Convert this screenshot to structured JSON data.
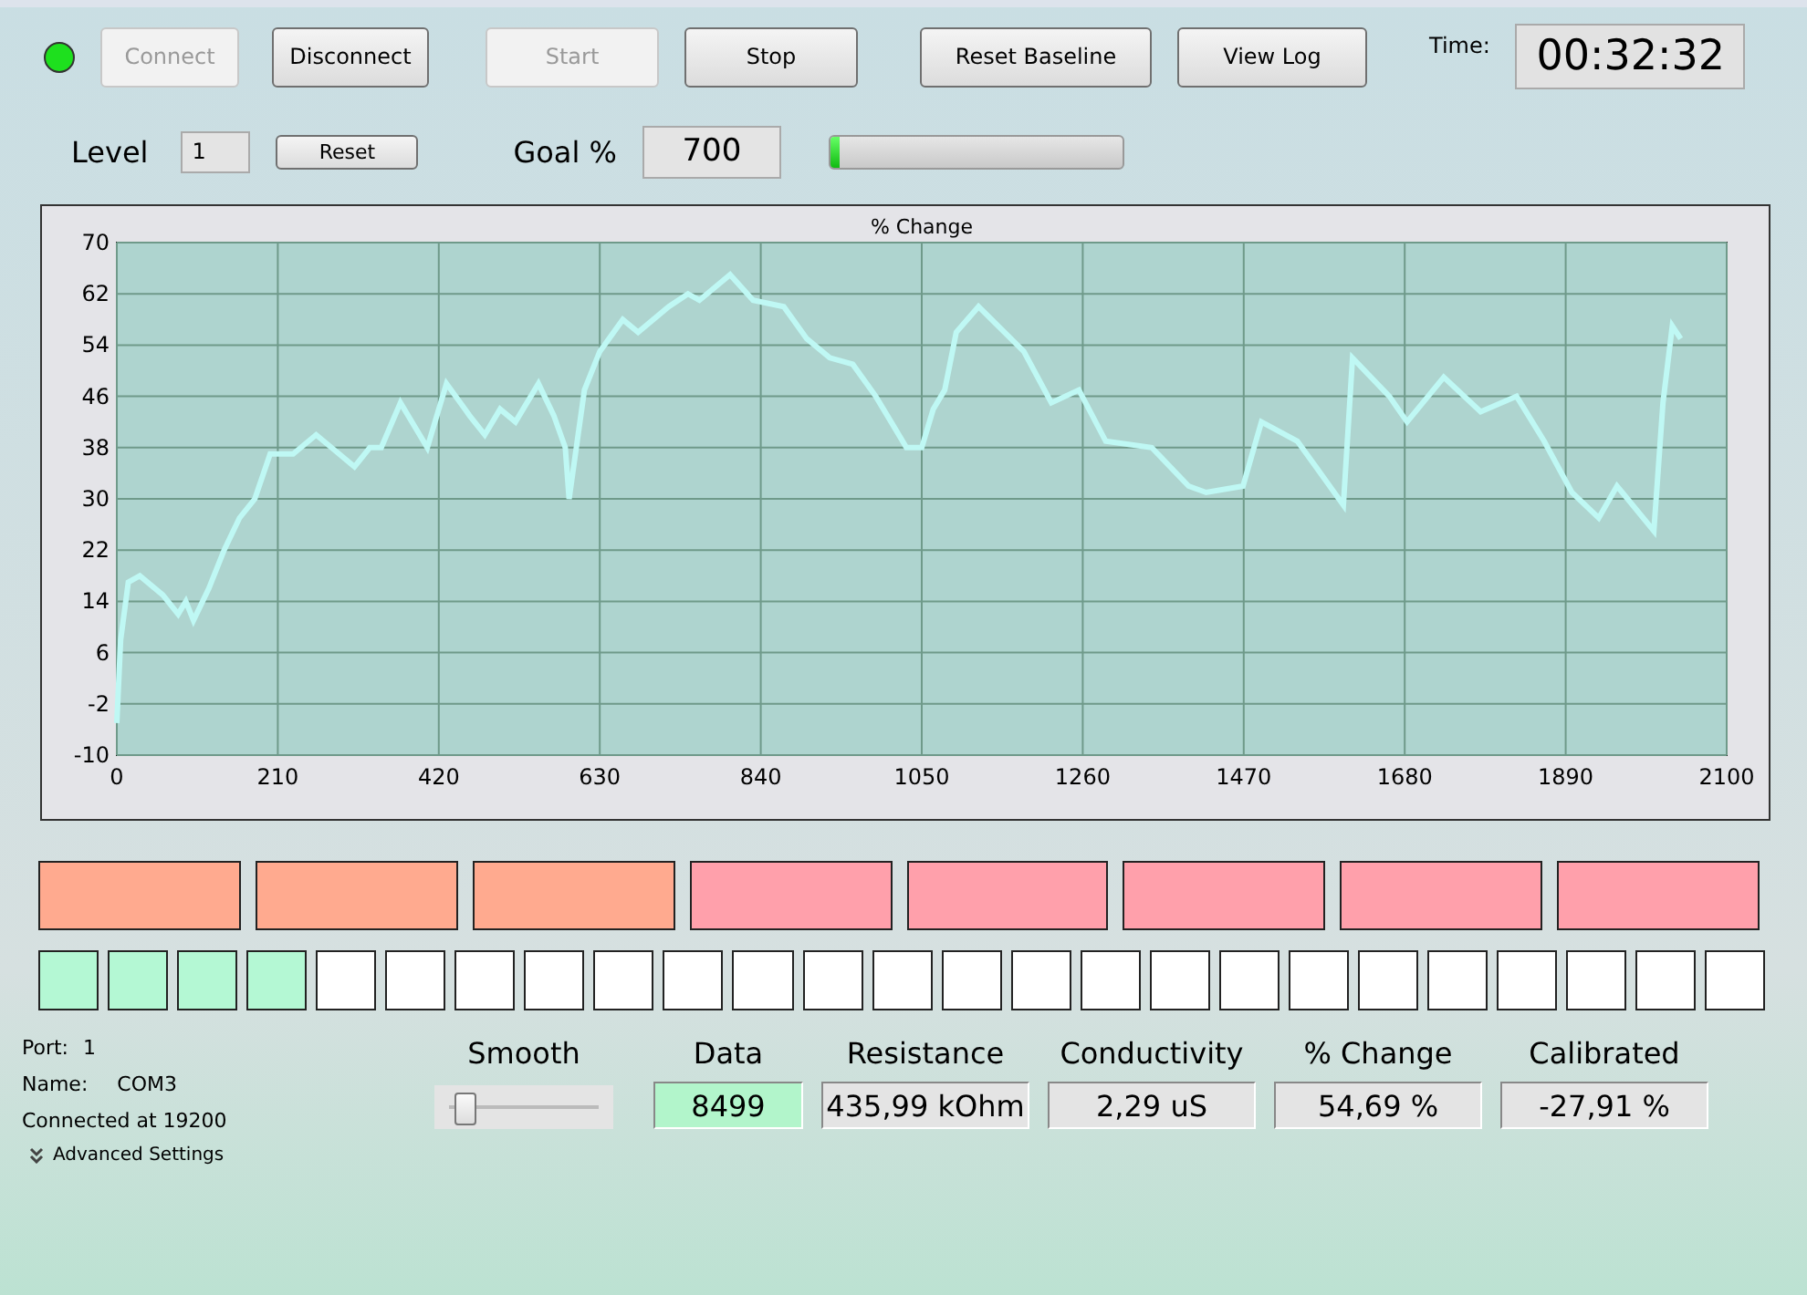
{
  "status_led": {
    "connected": true
  },
  "toolbar_buttons": [
    {
      "label": "Connect",
      "disabled": true
    },
    {
      "label": "Disconnect",
      "disabled": false
    },
    {
      "label": "Start",
      "disabled": true
    },
    {
      "label": "Stop",
      "disabled": false
    },
    {
      "label": "Reset Baseline",
      "disabled": false
    },
    {
      "label": "View Log",
      "disabled": false
    }
  ],
  "time": {
    "label": "Time:",
    "value": "00:32:32"
  },
  "level": {
    "label": "Level",
    "value": "1",
    "reset_button": "Reset"
  },
  "goal": {
    "label": "Goal %",
    "value": "700",
    "progress": {
      "level": 0.03
    }
  },
  "chart": {
    "chart_data": {
      "type": "line",
      "title": "% Change",
      "xlim": [
        0,
        2100
      ],
      "ylim": [
        -10,
        70
      ],
      "xticks": [
        0,
        210,
        420,
        630,
        840,
        1050,
        1260,
        1470,
        1680,
        1890,
        2100
      ],
      "yticks": [
        -10,
        -2,
        6,
        14,
        22,
        30,
        38,
        46,
        54,
        62,
        70
      ],
      "x": [
        0,
        5,
        15,
        30,
        60,
        80,
        90,
        100,
        120,
        140,
        160,
        180,
        200,
        230,
        260,
        290,
        310,
        330,
        345,
        370,
        390,
        405,
        430,
        460,
        480,
        500,
        520,
        550,
        570,
        585,
        590,
        610,
        630,
        660,
        680,
        720,
        745,
        760,
        800,
        830,
        870,
        900,
        930,
        960,
        990,
        1010,
        1030,
        1050,
        1065,
        1080,
        1095,
        1124,
        1183,
        1219,
        1255,
        1290,
        1350,
        1398,
        1421,
        1469,
        1493,
        1540,
        1564,
        1600,
        1612,
        1660,
        1683,
        1731,
        1779,
        1826,
        1862,
        1898,
        1933,
        1957,
        2005,
        2017,
        2029,
        2040
      ],
      "grid": true,
      "series": [
        {
          "color": "#bff8f4",
          "values": [
            -5,
            8,
            17,
            18,
            15,
            12,
            14,
            11,
            16,
            22,
            27,
            30,
            37,
            37,
            40,
            37,
            35,
            38,
            38,
            45,
            41,
            38,
            48,
            43,
            40,
            44,
            42,
            48,
            43,
            38,
            30,
            47,
            53,
            58,
            56,
            60,
            62,
            61,
            65,
            61,
            60,
            55,
            52,
            51,
            46,
            42,
            38,
            38,
            44,
            47,
            56,
            60,
            53,
            45,
            47,
            39,
            38,
            32,
            31,
            32,
            42,
            39,
            35,
            29,
            52,
            46,
            42,
            49,
            43.6,
            46,
            39,
            31,
            27,
            32,
            25,
            45,
            57,
            55
          ]
        }
      ]
    }
  },
  "threshold_blocks": [
    {
      "color": "#ffaa8f"
    },
    {
      "color": "#ffaa8f"
    },
    {
      "color": "#ffaa8f"
    },
    {
      "color": "#ffa0ab"
    },
    {
      "color": "#ffa0ab"
    },
    {
      "color": "#ffa0ab"
    },
    {
      "color": "#ffa0ab"
    },
    {
      "color": "#ffa0ab"
    }
  ],
  "level_cells": [
    {
      "filled": true
    },
    {
      "filled": true
    },
    {
      "filled": true
    },
    {
      "filled": true
    },
    {
      "filled": false
    },
    {
      "filled": false
    },
    {
      "filled": false
    },
    {
      "filled": false
    },
    {
      "filled": false
    },
    {
      "filled": false
    },
    {
      "filled": false
    },
    {
      "filled": false
    },
    {
      "filled": false
    },
    {
      "filled": false
    },
    {
      "filled": false
    },
    {
      "filled": false
    },
    {
      "filled": false
    },
    {
      "filled": false
    },
    {
      "filled": false
    },
    {
      "filled": false
    },
    {
      "filled": false
    },
    {
      "filled": false
    },
    {
      "filled": false
    },
    {
      "filled": false
    },
    {
      "filled": false
    }
  ],
  "connection": {
    "port_label": "Port:",
    "port": "1",
    "name_label": "Name:",
    "name": "COM3",
    "status": "Connected at 19200",
    "advanced": "Advanced Settings"
  },
  "smooth": {
    "label": "Smooth",
    "level": 0.1
  },
  "readouts": [
    {
      "label": "Data",
      "value": "8499",
      "highlighted": true
    },
    {
      "label": "Resistance",
      "value": "435,99 kOhm",
      "highlighted": false
    },
    {
      "label": "Conductivity",
      "value": "2,29 uS",
      "highlighted": false
    },
    {
      "label": "% Change",
      "value": "54,69 %",
      "highlighted": false
    },
    {
      "label": "Calibrated",
      "value": "-27,91 %",
      "highlighted": false
    }
  ]
}
